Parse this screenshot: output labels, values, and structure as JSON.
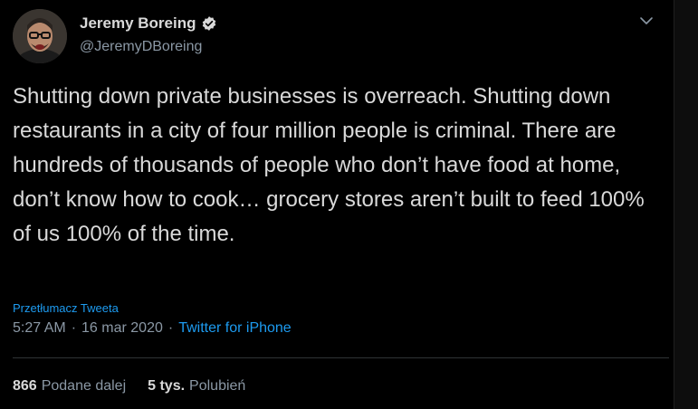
{
  "author": {
    "name": "Jeremy Boreing",
    "handle": "@JeremyDBoreing",
    "verified": true
  },
  "tweet": {
    "text": "Shutting down private businesses is overreach. Shutting down restaurants in a city of four million people is criminal. There are hundreds of thousands of people who don’t have food at home, don’t know how to cook… grocery stores aren’t built to feed 100% of us 100% of the time.",
    "translate_label": "Przetłumacz Tweeta",
    "time": "5:27 AM",
    "sep1": "·",
    "date": "16 mar 2020",
    "sep2": "·",
    "source": "Twitter for iPhone"
  },
  "stats": {
    "retweets_count": "866",
    "retweets_label": "Podane dalej",
    "likes_count": "5 tys.",
    "likes_label": "Polubień"
  },
  "icons": {
    "verified": "verified-badge-icon",
    "menu": "chevron-down-icon"
  },
  "colors": {
    "background": "#000000",
    "text": "#d9d9d9",
    "secondary": "#8b98a5",
    "accent": "#1d9bf0"
  }
}
